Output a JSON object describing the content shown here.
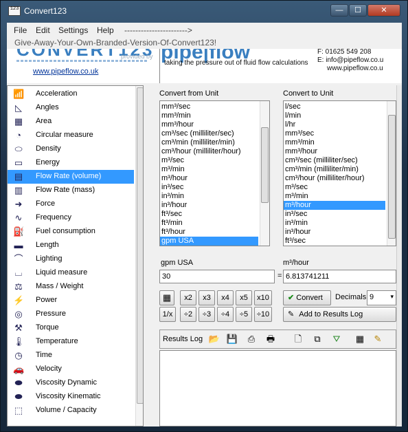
{
  "window": {
    "title": "Convert123",
    "icon_text": "123"
  },
  "titlebar_buttons": {
    "minimize": "—",
    "maximize": "☐",
    "close": "✕"
  },
  "menu": {
    "file": "File",
    "edit": "Edit",
    "settings": "Settings",
    "help": "Help",
    "arrow": "----------------------->"
  },
  "giveaway": "Give-Away-Your-Own-Branded-Version-Of-Convert123!",
  "banner": {
    "provided_by": "provided by",
    "link": "www.pipeflow.co.uk",
    "tagline": "taking the pressure out of fluid flow calculations",
    "phone": "F: 01625 549 208",
    "email": "E: info@pipeflow.co.u",
    "web": "www.pipeflow.co.u"
  },
  "categories": [
    {
      "label": "Acceleration",
      "icon": "acceleration-icon",
      "glyph": "📶"
    },
    {
      "label": "Angles",
      "icon": "angle-icon",
      "glyph": "◺"
    },
    {
      "label": "Area",
      "icon": "area-grid-icon",
      "glyph": "▦"
    },
    {
      "label": "Circular measure",
      "icon": "pie-icon",
      "glyph": "◔"
    },
    {
      "label": "Density",
      "icon": "density-icon",
      "glyph": "⬭"
    },
    {
      "label": "Energy",
      "icon": "battery-icon",
      "glyph": "▭"
    },
    {
      "label": "Flow Rate (volume)",
      "icon": "flow-volume-icon",
      "glyph": "▤",
      "selected": true
    },
    {
      "label": "Flow Rate (mass)",
      "icon": "flow-mass-icon",
      "glyph": "▥"
    },
    {
      "label": "Force",
      "icon": "force-icon",
      "glyph": "➜"
    },
    {
      "label": "Frequency",
      "icon": "wave-icon",
      "glyph": "∿"
    },
    {
      "label": "Fuel consumption",
      "icon": "fuel-icon",
      "glyph": "⛽"
    },
    {
      "label": "Length",
      "icon": "ruler-icon",
      "glyph": "▬"
    },
    {
      "label": "Lighting",
      "icon": "lamp-icon",
      "glyph": "⌒"
    },
    {
      "label": "Liquid measure",
      "icon": "beaker-icon",
      "glyph": "⌴"
    },
    {
      "label": "Mass / Weight",
      "icon": "weight-icon",
      "glyph": "⚖"
    },
    {
      "label": "Power",
      "icon": "power-icon",
      "glyph": "⚡"
    },
    {
      "label": "Pressure",
      "icon": "gauge-icon",
      "glyph": "◎"
    },
    {
      "label": "Torque",
      "icon": "wrench-icon",
      "glyph": "⚒"
    },
    {
      "label": "Temperature",
      "icon": "thermometer-icon",
      "glyph": "🌡"
    },
    {
      "label": "Time",
      "icon": "clock-icon",
      "glyph": "◷"
    },
    {
      "label": "Velocity",
      "icon": "car-icon",
      "glyph": "🚗"
    },
    {
      "label": "Viscosity Dynamic",
      "icon": "viscosity-dynamic-icon",
      "glyph": "⬬"
    },
    {
      "label": "Viscosity Kinematic",
      "icon": "viscosity-kinematic-icon",
      "glyph": "⬬"
    },
    {
      "label": "Volume / Capacity",
      "icon": "cube-icon",
      "glyph": "⬚"
    }
  ],
  "convert_from": {
    "label": "Convert from Unit",
    "items": [
      "mm³/sec",
      "mm³/min",
      "mm³/hour",
      "cm³/sec (milliliter/sec)",
      "cm³/min (milliliter/min)",
      "cm³/hour (milliliter/hour)",
      "m³/sec",
      "m³/min",
      "m³/hour",
      "in³/sec",
      "in³/min",
      "in³/hour",
      "ft³/sec",
      "ft³/min",
      "ft³/hour",
      "gpm USA"
    ],
    "selected_index": 15
  },
  "convert_to": {
    "label": "Convert to Unit",
    "items": [
      "l/sec",
      "l/min",
      "l/hr",
      "mm³/sec",
      "mm³/min",
      "mm³/hour",
      "cm³/sec (milliliter/sec)",
      "cm³/min (milliliter/min)",
      "cm³/hour (milliliter/hour)",
      "m³/sec",
      "m³/min",
      "m³/hour",
      "in³/sec",
      "in³/min",
      "in³/hour",
      "ft³/sec"
    ],
    "selected_index": 11
  },
  "from_unit_label": "gpm USA",
  "to_unit_label": "m³/hour",
  "from_value": "30",
  "equals": "=",
  "to_value": "6.813741211",
  "multiply_buttons": [
    "x2",
    "x3",
    "x4",
    "x5",
    "x10"
  ],
  "divide_buttons": [
    "1/x",
    "÷2",
    "÷3",
    "÷4",
    "÷5",
    "÷10"
  ],
  "convert_button": "Convert",
  "decimals_label": "Decimals",
  "decimals_value": "9",
  "add_log_button": "Add to Results Log",
  "results_log_label": "Results Log"
}
